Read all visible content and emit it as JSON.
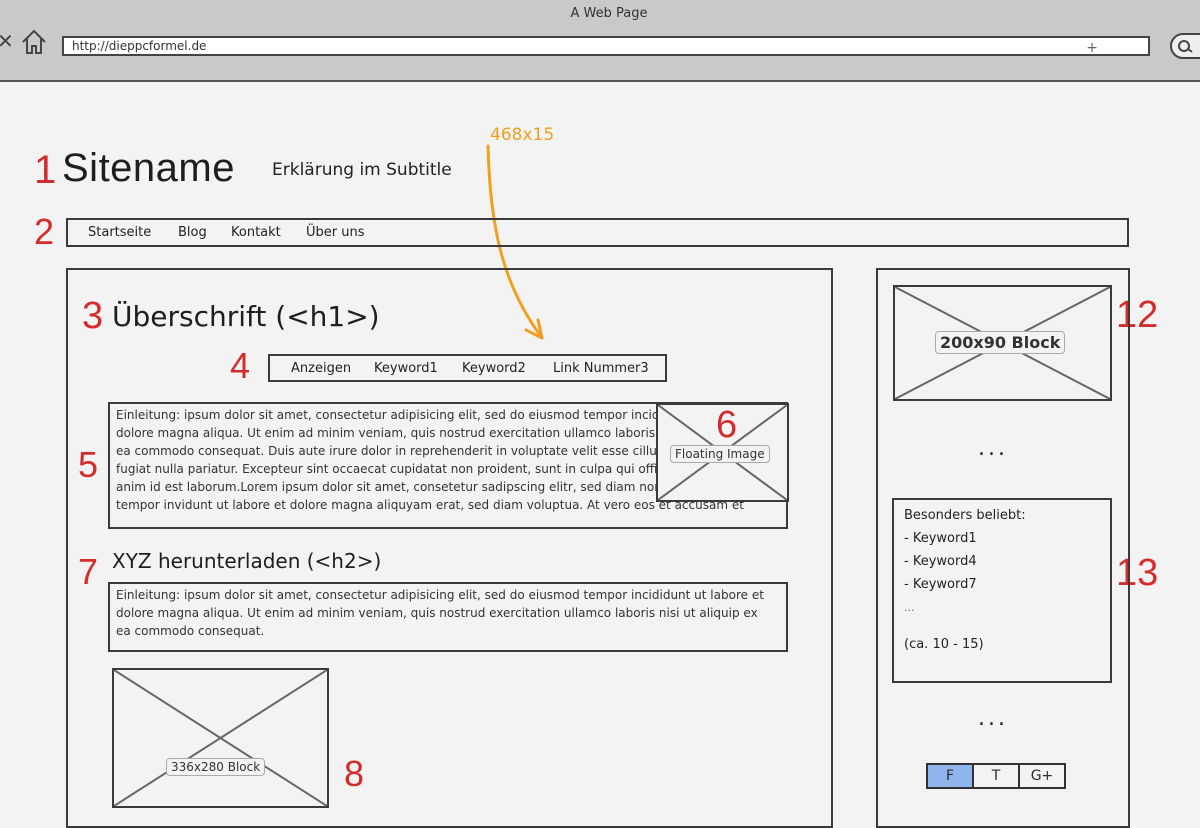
{
  "browser": {
    "title": "A Web Page",
    "url": "http://dieppcformel.de"
  },
  "annotations": {
    "n1": "1",
    "n2": "2",
    "n3": "3",
    "n4": "4",
    "n5": "5",
    "n6": "6",
    "n7": "7",
    "n8": "8",
    "n12": "12",
    "n13": "13",
    "size_hint": "468x15"
  },
  "header": {
    "site_name": "Sitename",
    "subtitle": "Erklärung im Subtitle"
  },
  "nav": {
    "items": [
      "Startseite",
      "Blog",
      "Kontakt",
      "Über uns"
    ]
  },
  "main": {
    "heading": "Überschrift (<h1>)",
    "keyword_links": [
      "Anzeigen",
      "Keyword1",
      "Keyword2",
      "Link Nummer3"
    ],
    "intro_paragraph": "Einleitung: ipsum dolor sit amet, consectetur adipisicing elit, sed do eiusmod tempor incididunt ut labore et\ndolore magna aliqua. Ut enim ad minim veniam, quis nostrud exercitation ullamco laboris nisi ut aliquip ex\nea commodo consequat. Duis aute irure dolor in reprehenderit in voluptate velit esse cillum dolore eu\nfugiat nulla pariatur. Excepteur sint occaecat cupidatat non proident, sunt in culpa qui officia deserunt mollit\nanim id est laborum.Lorem ipsum dolor sit amet, consetetur sadipscing elitr, sed diam nonumy eirmod\ntempor invidunt ut labore et dolore magna aliquyam erat, sed diam voluptua. At vero eos et accusam et",
    "floating_image_label": "Floating Image",
    "subheading": "XYZ herunterladen (<h2>)",
    "second_paragraph": "Einleitung: ipsum dolor sit amet, consectetur adipisicing elit, sed do eiusmod tempor incididunt ut labore et\ndolore magna aliqua. Ut enim ad minim veniam, quis nostrud exercitation ullamco laboris nisi ut aliquip ex\nea commodo consequat.",
    "block_label": "336x280 Block"
  },
  "sidebar": {
    "block_label": "200x90 Block",
    "ellipsis": "...",
    "popular_title": "Besonders beliebt:",
    "popular_items": [
      "- Keyword1",
      "- Keyword4",
      "- Keyword7"
    ],
    "popular_more": "...",
    "popular_note": "(ca. 10 - 15)",
    "social_buttons": [
      "F",
      "T",
      "G+"
    ]
  },
  "colors": {
    "annotation_number": "#d42c2c",
    "annotation_arrow": "#f0a020",
    "social_active": "#8fb6ec"
  }
}
